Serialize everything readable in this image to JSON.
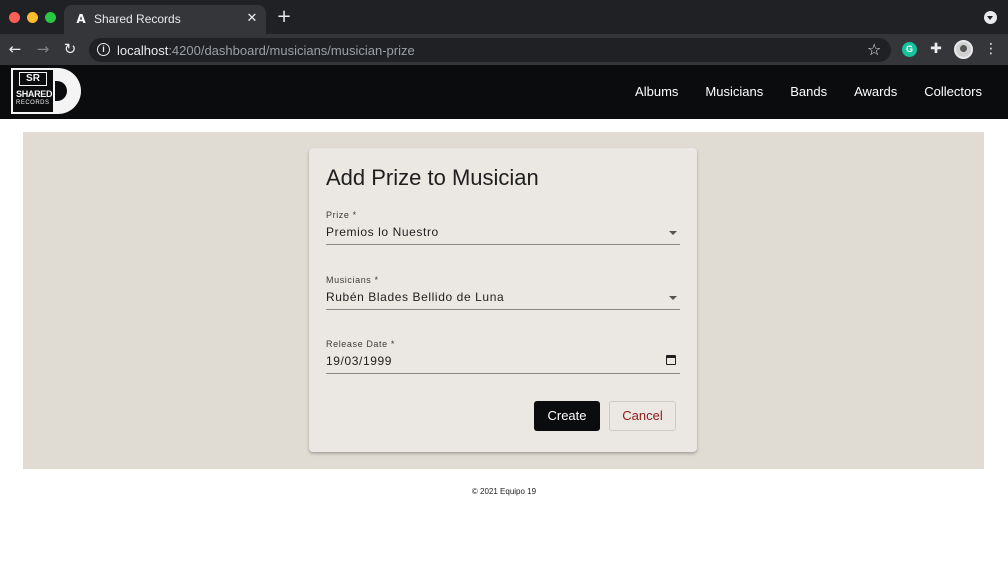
{
  "browser": {
    "tab_title": "Shared Records",
    "tab_favicon": "A",
    "url_host": "localhost",
    "url_rest": ":4200/dashboard/musicians/musician-prize",
    "icons": {
      "back": "back-arrow-icon",
      "forward": "forward-arrow-icon",
      "reload": "reload-icon",
      "info": "info-icon",
      "bookmark": "star-icon",
      "grammarly": "grammarly-icon",
      "extensions": "puzzle-icon",
      "menu": "kebab-menu-icon"
    }
  },
  "header": {
    "logo": {
      "badge": "SR",
      "line1": "SHARED",
      "line2": "RECORDS"
    },
    "nav": [
      {
        "label": "Albums"
      },
      {
        "label": "Musicians"
      },
      {
        "label": "Bands"
      },
      {
        "label": "Awards"
      },
      {
        "label": "Collectors"
      }
    ]
  },
  "form": {
    "title": "Add Prize to Musician",
    "prize": {
      "label": "Prize *",
      "value": "Premios lo Nuestro"
    },
    "musician": {
      "label": "Musicians *",
      "value": "Rubén Blades Bellido de Luna"
    },
    "release_date": {
      "label": "Release Date *",
      "value": "19/03/1999"
    },
    "create_label": "Create",
    "cancel_label": "Cancel"
  },
  "footer": {
    "text": "© 2021 Equipo 19"
  },
  "colors": {
    "header_bg": "#0b0c0e",
    "content_bg": "#e0dbd3",
    "card_bg": "#ebe7e2",
    "cancel_text": "#8b1a1a"
  }
}
